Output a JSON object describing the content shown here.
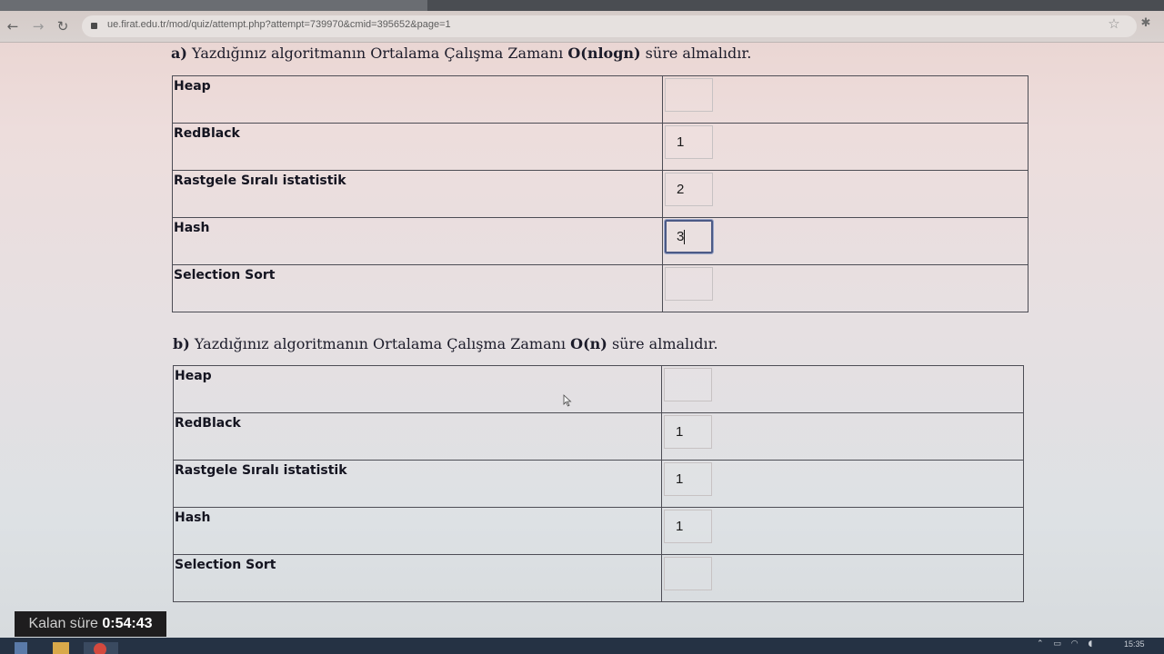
{
  "browser": {
    "url": "ue.firat.edu.tr/mod/quiz/attempt.php?attempt=739970&cmid=395652&page=1",
    "icons": [
      "back-icon",
      "forward-icon",
      "reload-icon",
      "lock-icon",
      "star-icon",
      "extension-icon"
    ]
  },
  "questions": [
    {
      "letter": "a)",
      "text_before": " Yazdığınız algoritmanın Ortalama Çalışma Zamanı ",
      "complexity": "O(nlogn)",
      "text_after": " süre almalıdır.",
      "rows": [
        {
          "label": "Heap",
          "answer": ""
        },
        {
          "label": "RedBlack",
          "answer": "1"
        },
        {
          "label": "Rastgele Sıralı istatistik",
          "answer": "2"
        },
        {
          "label": "Hash",
          "answer": "3"
        },
        {
          "label": "Selection Sort",
          "answer": ""
        }
      ]
    },
    {
      "letter": "b)",
      "text_before": " Yazdığınız algoritmanın Ortalama Çalışma Zamanı ",
      "complexity": "O(n)",
      "text_after": " süre almalıdır.",
      "rows": [
        {
          "label": "Heap",
          "answer": ""
        },
        {
          "label": "RedBlack",
          "answer": "1"
        },
        {
          "label": "Rastgele Sıralı istatistik",
          "answer": "1"
        },
        {
          "label": "Hash",
          "answer": "1"
        },
        {
          "label": "Selection Sort",
          "answer": ""
        }
      ]
    }
  ],
  "timer": {
    "label": "Kalan süre",
    "value": "0:54:43"
  },
  "taskbar": {
    "clock": "15:35"
  },
  "colors": {
    "focus_border": "#4c5a86",
    "timer_bg": "#1e1d1e",
    "taskbar_bg": "#253244"
  }
}
